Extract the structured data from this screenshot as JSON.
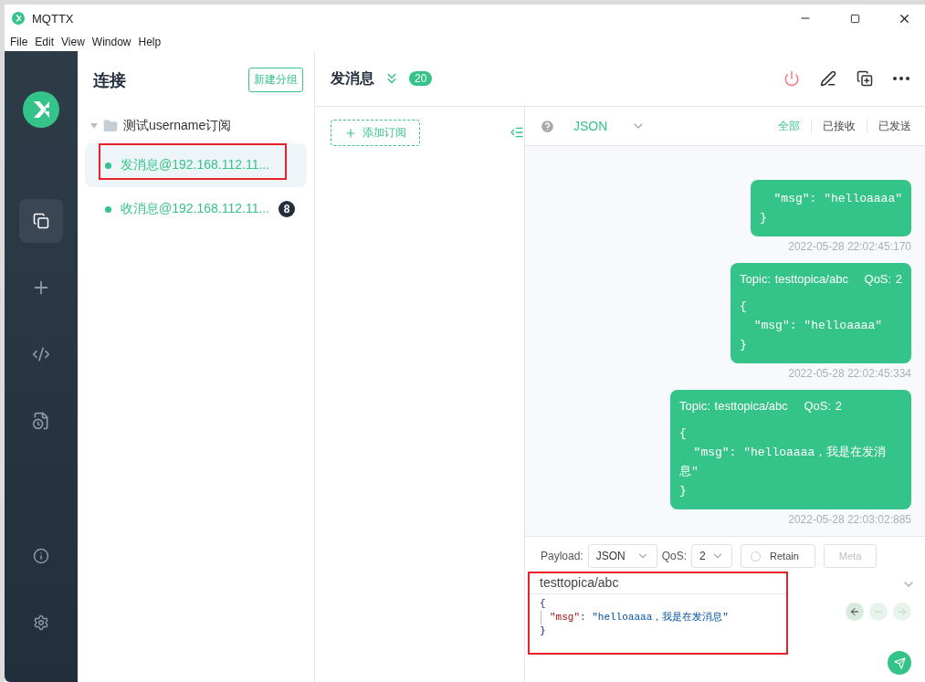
{
  "window": {
    "title": "MQTTX"
  },
  "menu": [
    "File",
    "Edit",
    "View",
    "Window",
    "Help"
  ],
  "nav": [
    {
      "kind": "connections",
      "selected": true
    },
    {
      "kind": "new",
      "selected": false
    },
    {
      "kind": "script",
      "selected": false
    },
    {
      "kind": "log",
      "selected": false
    }
  ],
  "nav_bottom": [
    {
      "kind": "about"
    },
    {
      "kind": "settings"
    }
  ],
  "connections": {
    "title": "连接",
    "new_group": "新建分组",
    "group": {
      "name": "测试username订阅",
      "expanded": true,
      "items": [
        {
          "name": "发消息@192.168.112.11...",
          "selected": true,
          "highlighted": true
        },
        {
          "name": "收消息@192.168.112.11...",
          "selected": false,
          "highlighted": false,
          "badge": "8"
        }
      ]
    }
  },
  "header": {
    "title": "发消息",
    "count": "20"
  },
  "subscriptions": {
    "add": "添加订阅"
  },
  "toolbar": {
    "format": "JSON",
    "filters": [
      {
        "label": "全部",
        "selected": true
      },
      {
        "label": "已接收",
        "selected": false
      },
      {
        "label": "已发送",
        "selected": false
      }
    ]
  },
  "messages": [
    {
      "body": "  \"msg\": \"helloaaaa\"\n}",
      "time": "2022-05-28 22:02:45:170"
    },
    {
      "topic": "Topic: testtopica/abc",
      "qos": "QoS: 2",
      "body": "{\n  \"msg\": \"helloaaaa\"\n}",
      "time": "2022-05-28 22:02:45:334"
    },
    {
      "topic": "Topic: testtopica/abc",
      "qos": "QoS: 2",
      "body": "{\n  \"msg\": \"helloaaaa，我是在发消息\"\n}",
      "time": "2022-05-28 22:03:02:885"
    }
  ],
  "composer": {
    "payload_label": "Payload:",
    "payload": "JSON",
    "qos_label": "QoS:",
    "qos": "2",
    "retain": {
      "label": "Retain",
      "checked": false
    },
    "meta": {
      "label": "Meta",
      "disabled": true
    },
    "topic": "testtopica/abc",
    "highlighted": true,
    "lines": [
      {
        "kind": "brace",
        "text": "{"
      },
      {
        "kind": "pair",
        "key": "\"msg\"",
        "sep": ": ",
        "value": "\"helloaaaa，我是在发消息\""
      },
      {
        "kind": "brace",
        "text": "}"
      }
    ],
    "history": [
      {
        "kind": "back",
        "disabled": false
      },
      {
        "kind": "reset",
        "disabled": true
      },
      {
        "kind": "forward",
        "disabled": true
      }
    ]
  }
}
